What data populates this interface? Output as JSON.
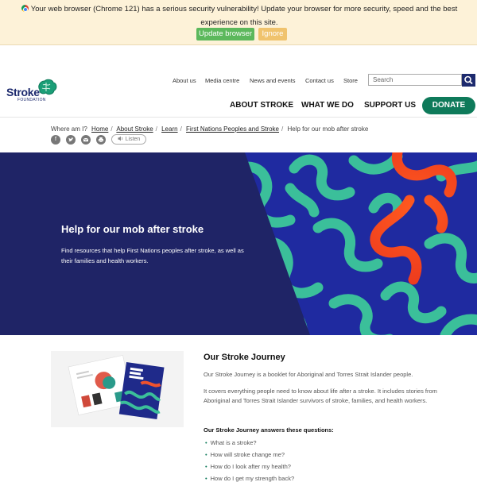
{
  "update_banner": {
    "message": "Your web browser (Chrome 121) has a serious security vulnerability! Update your browser for more security, speed and the best experience on this site.",
    "update_label": "Update browser",
    "ignore_label": "Ignore"
  },
  "logo": {
    "word": "Stroke",
    "sub": "FOUNDATION"
  },
  "top_nav": [
    "About us",
    "Media centre",
    "News and events",
    "Contact us",
    "Store"
  ],
  "search": {
    "placeholder": "Search"
  },
  "main_nav": [
    "ABOUT STROKE",
    "WHAT WE DO",
    "SUPPORT US"
  ],
  "donate_label": "DONATE",
  "breadcrumb": {
    "prefix": "Where am I?",
    "links": [
      "Home",
      "About Stroke",
      "Learn",
      "First Nations Peoples and Stroke"
    ],
    "current": "Help for our mob after stroke"
  },
  "share_icons": [
    "facebook-icon",
    "twitter-icon",
    "email-icon",
    "print-icon"
  ],
  "listen_label": "Listen",
  "hero": {
    "title": "Help for our mob after stroke",
    "text": "Find resources that help First Nations peoples after stroke, as well as their families and health workers."
  },
  "journey": {
    "title": "Our Stroke Journey",
    "p1": "Our Stroke Journey is a booklet for Aboriginal and Torres Strait Islander people.",
    "p2": "It covers everything people need to know about life after a stroke. It includes stories from Aboriginal and Torres Strait Islander survivors of stroke, families, and health workers.",
    "questions_heading": "Our Stroke Journey answers these questions:",
    "questions": [
      "What is a stroke?",
      "How will stroke change me?",
      "How do I look after my health?",
      "How do I get my strength back?"
    ]
  },
  "colors": {
    "navy": "#1f2466",
    "green": "#0e7a5a",
    "teal": "#3bbf9a",
    "orange": "#f0522d",
    "banner_bg": "#fdf2d8"
  }
}
